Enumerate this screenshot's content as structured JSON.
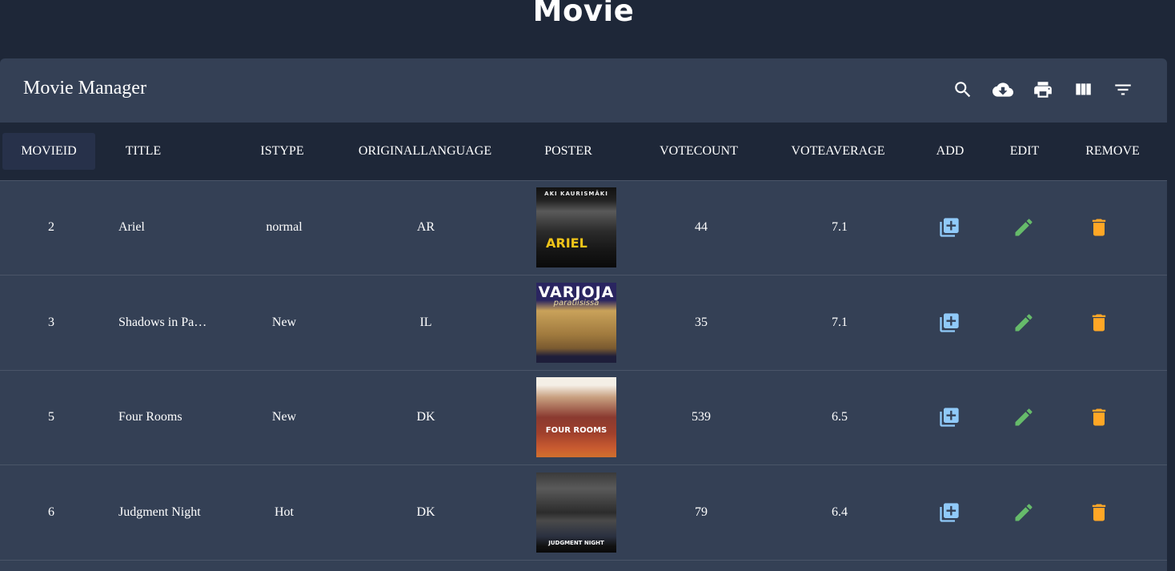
{
  "page": {
    "title": "Movie"
  },
  "toolbar": {
    "title": "Movie Manager",
    "icons": [
      "search-icon",
      "cloud-download-icon",
      "print-icon",
      "view-column-icon",
      "filter-list-icon"
    ]
  },
  "table": {
    "columns": [
      "MOVIEID",
      "TITLE",
      "ISTYPE",
      "ORIGINALLANGUAGE",
      "POSTER",
      "VOTECOUNT",
      "VOTEAVERAGE",
      "ADD",
      "EDIT",
      "REMOVE"
    ],
    "rows": [
      {
        "movieid": "2",
        "title": "Ariel",
        "istype": "normal",
        "lang": "AR",
        "votecount": "44",
        "voteaverage": "7.1",
        "poster": {
          "top": "AKI KAURISMÄKI",
          "main": "ARIEL"
        }
      },
      {
        "movieid": "3",
        "title": "Shadows in Pa…",
        "istype": "New",
        "lang": "IL",
        "votecount": "35",
        "voteaverage": "7.1",
        "poster": {
          "top": "VARJOJA",
          "main": "paratiisissa"
        }
      },
      {
        "movieid": "5",
        "title": "Four Rooms",
        "istype": "New",
        "lang": "DK",
        "votecount": "539",
        "voteaverage": "6.5",
        "poster": {
          "top": "",
          "main": "FOUR ROOMS"
        }
      },
      {
        "movieid": "6",
        "title": "Judgment Night",
        "istype": "Hot",
        "lang": "DK",
        "votecount": "79",
        "voteaverage": "6.4",
        "poster": {
          "top": "",
          "main": "JUDGMENT NIGHT"
        }
      }
    ]
  },
  "colors": {
    "add": "#90caf9",
    "edit": "#66bb6a",
    "remove": "#ffa726",
    "background": "#1e2738",
    "panel": "#344055"
  }
}
